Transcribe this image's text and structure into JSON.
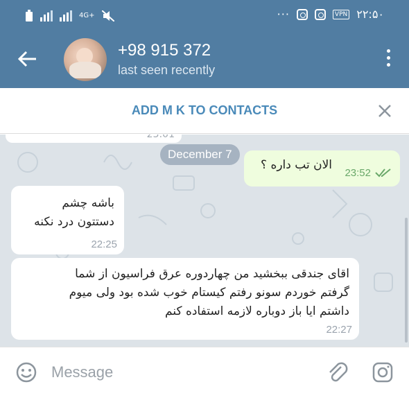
{
  "status_bar": {
    "time": "۲۲:۵۰",
    "network": "4G+",
    "vpn_label": "VPN",
    "overflow": "···"
  },
  "toolbar": {
    "contact_name": "+98 915 372",
    "contact_status": "last seen recently"
  },
  "add_contact": {
    "label": "ADD M K TO CONTACTS"
  },
  "chat": {
    "previous_time": "23:01",
    "date_label": "December 7",
    "messages": [
      {
        "direction": "out",
        "text": "الان تب داره ؟",
        "time": "23:52",
        "status": "read"
      },
      {
        "direction": "in",
        "text": "باشه چشم\nدستتون درد نکنه",
        "time": "22:25"
      },
      {
        "direction": "in",
        "text": "اقای جندقی ببخشید من چهاردوره عرق فراسیون از شما\nگرفتم خوردم سونو رفتم کیستام خوب شده بود ولی میوم\nداشتم ایا باز دوباره لازمه استفاده کنم",
        "time": "22:27"
      }
    ]
  },
  "composer": {
    "placeholder": "Message"
  },
  "colors": {
    "header": "#517da2",
    "outgoing_bubble": "#effdde",
    "accent": "#4a8ab9"
  }
}
